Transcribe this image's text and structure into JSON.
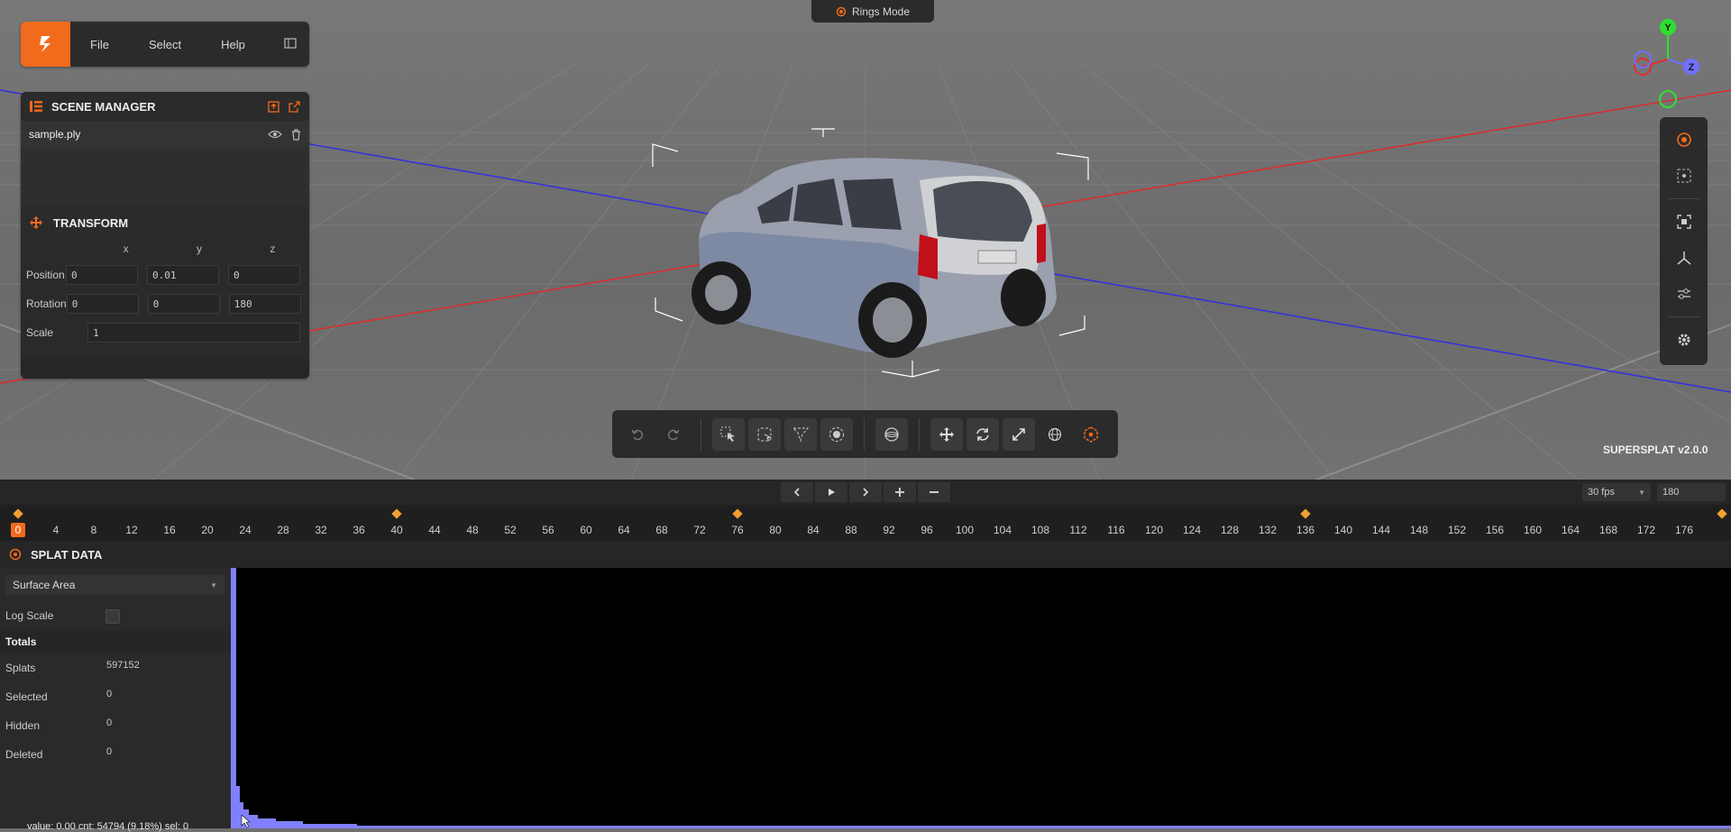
{
  "menu": {
    "items": [
      "File",
      "Select",
      "Help"
    ]
  },
  "mode_pill": {
    "label": "Rings Mode"
  },
  "scene_manager": {
    "title": "SCENE MANAGER",
    "splat_name": "sample.ply",
    "transform_title": "TRANSFORM",
    "columns": [
      "x",
      "y",
      "z"
    ],
    "position_label": "Position",
    "rotation_label": "Rotation",
    "scale_label": "Scale",
    "position": [
      "0",
      "0.01",
      "0"
    ],
    "rotation": [
      "0",
      "0",
      "180"
    ],
    "scale": "1"
  },
  "gizmo": {
    "y": "Y",
    "z": "Z"
  },
  "version": "SUPERSPLAT v2.0.0",
  "timeline": {
    "fps": "30 fps",
    "frames": "180",
    "current_frame": "0",
    "ticks": [
      "0",
      "4",
      "8",
      "12",
      "16",
      "20",
      "24",
      "28",
      "32",
      "36",
      "40",
      "44",
      "48",
      "52",
      "56",
      "60",
      "64",
      "68",
      "72",
      "76",
      "80",
      "84",
      "88",
      "92",
      "96",
      "100",
      "104",
      "108",
      "112",
      "116",
      "120",
      "124",
      "128",
      "132",
      "136",
      "140",
      "144",
      "148",
      "152",
      "156",
      "160",
      "164",
      "168",
      "172",
      "176"
    ],
    "keyframes": [
      0,
      40,
      76,
      136,
      180
    ]
  },
  "splat_data": {
    "title": "SPLAT DATA",
    "metric": "Surface Area",
    "log_scale_label": "Log Scale",
    "totals_label": "Totals",
    "rows": [
      {
        "label": "Splats",
        "value": "597152"
      },
      {
        "label": "Selected",
        "value": "0"
      },
      {
        "label": "Hidden",
        "value": "0"
      },
      {
        "label": "Deleted",
        "value": "0"
      }
    ],
    "hover_readout": "value: 0.00 cnt: 54794 (9.18%) sel: 0"
  },
  "colors": {
    "accent": "#f26a1b",
    "histogram": "#8080ff",
    "keyframe": "#f0a030"
  },
  "icons": [
    "logo-icon",
    "panel-toggle-icon",
    "rings-icon",
    "scene-list-icon",
    "import-icon",
    "export-icon",
    "eye-icon",
    "trash-icon",
    "move-icon",
    "undo-icon",
    "redo-icon",
    "picker-select-icon",
    "lasso-select-icon",
    "polygon-select-icon",
    "brush-select-icon",
    "sphere-select-icon",
    "translate-icon",
    "rotate-icon",
    "scale-icon",
    "world-space-icon",
    "pivot-icon",
    "centers-icon",
    "rings-mode-icon",
    "frame-selection-icon",
    "axes-icon",
    "color-adjust-icon",
    "settings-icon",
    "play-icon",
    "prev-frame-icon",
    "next-frame-icon",
    "add-key-icon",
    "remove-key-icon"
  ]
}
